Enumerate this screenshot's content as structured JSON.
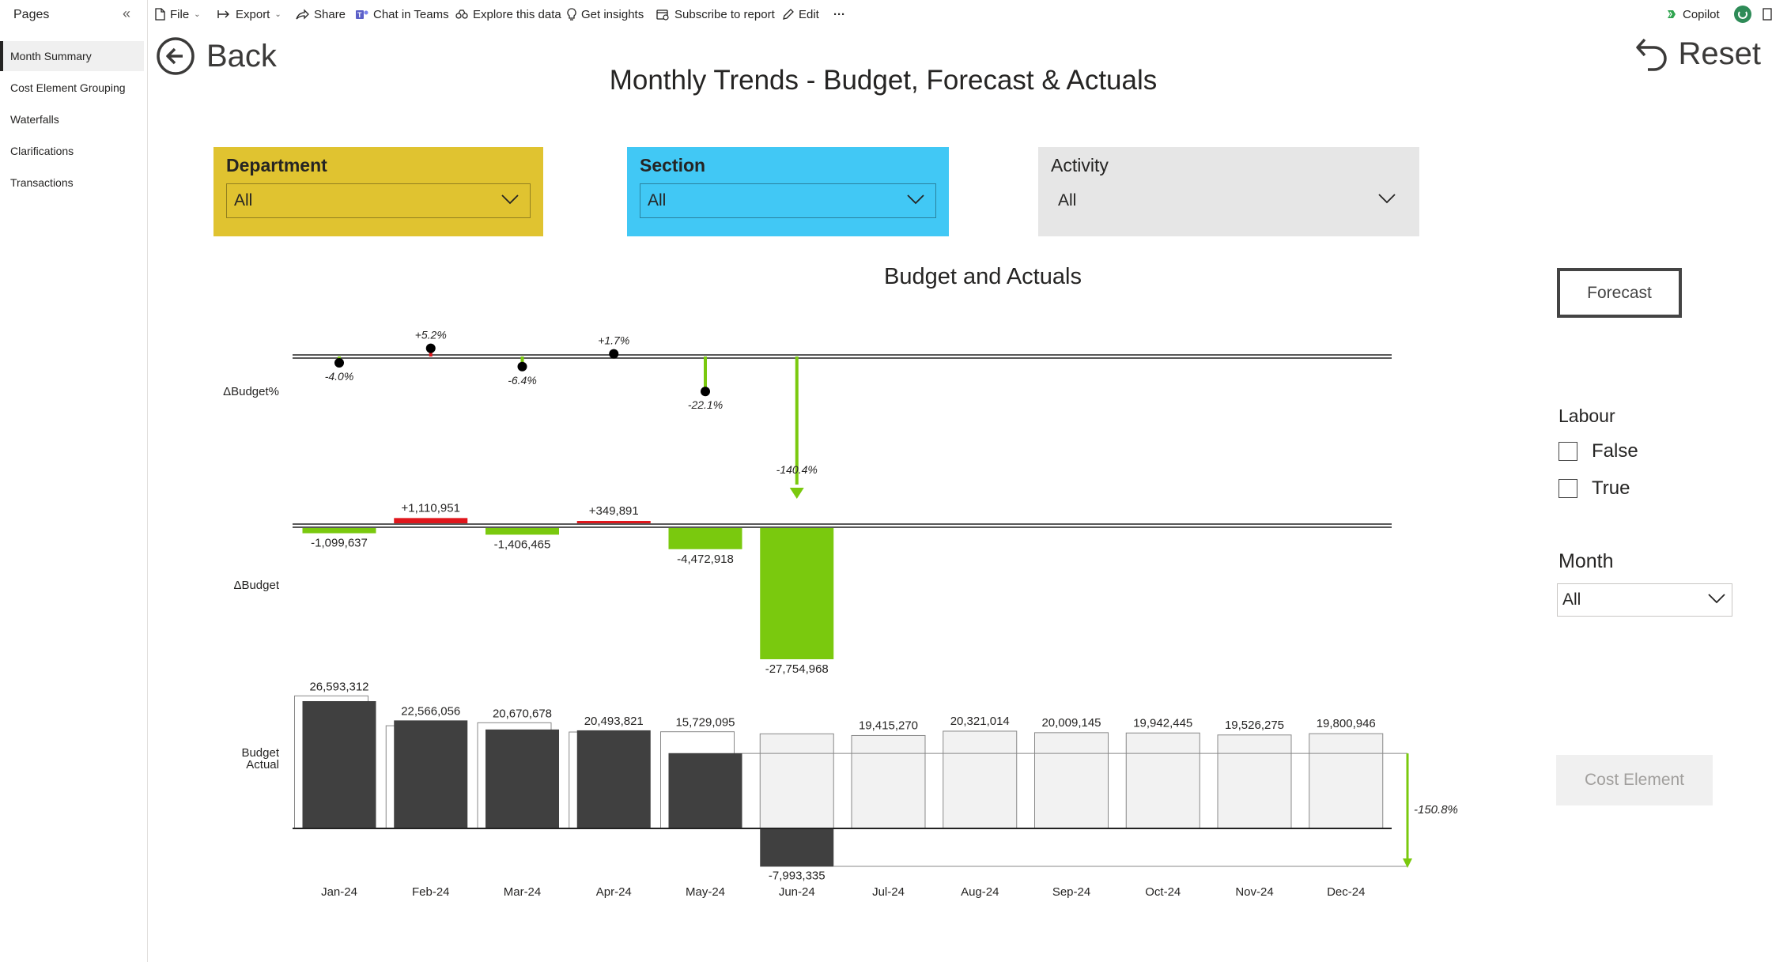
{
  "toolbar": {
    "file": "File",
    "export": "Export",
    "share": "Share",
    "chat_in_teams": "Chat in Teams",
    "explore": "Explore this data",
    "insights": "Get insights",
    "subscribe": "Subscribe to report",
    "edit": "Edit",
    "more": "···",
    "copilot": "Copilot"
  },
  "sidebar": {
    "title": "Pages",
    "collapse": "«",
    "items": [
      {
        "label": "Month Summary",
        "active": true
      },
      {
        "label": "Cost Element Grouping"
      },
      {
        "label": "Waterfalls"
      },
      {
        "label": "Clarifications"
      },
      {
        "label": "Transactions"
      }
    ]
  },
  "page": {
    "back_label": "Back",
    "reset_label": "Reset",
    "title": "Monthly Trends - Budget, Forecast & Actuals"
  },
  "slicers": {
    "department": {
      "label": "Department",
      "value": "All",
      "color": "#E0C330"
    },
    "section": {
      "label": "Section",
      "value": "All",
      "color": "#41C8F5"
    },
    "activity": {
      "label": "Activity",
      "value": "All",
      "color": "#E6E6E6"
    }
  },
  "right_panel": {
    "forecast_button": "Forecast",
    "labour_title": "Labour",
    "labour_options": [
      "False",
      "True"
    ],
    "month_title": "Month",
    "month_value": "All",
    "cost_element_button": "Cost Element"
  },
  "chart_data": {
    "type": "bar",
    "title": "Budget and Actuals",
    "categories": [
      "Jan-24",
      "Feb-24",
      "Mar-24",
      "Apr-24",
      "May-24",
      "Jun-24",
      "Jul-24",
      "Aug-24",
      "Sep-24",
      "Oct-24",
      "Nov-24",
      "Dec-24"
    ],
    "row_labels": {
      "delta_pct": "ΔBudget%",
      "delta": "ΔBudget",
      "budget_actual": [
        "Budget",
        "Actual"
      ]
    },
    "delta_budget_pct": [
      -4.0,
      5.2,
      -6.4,
      1.7,
      -22.1,
      -140.4,
      null,
      null,
      null,
      null,
      null,
      null
    ],
    "delta_budget_pct_labels": [
      "-4.0%",
      "+5.2%",
      "-6.4%",
      "+1.7%",
      "-22.1%",
      "-140.4%",
      "",
      "",
      "",
      "",
      "",
      ""
    ],
    "delta_budget": [
      -1099637,
      1110951,
      -1406465,
      349891,
      -4472918,
      -27754968,
      null,
      null,
      null,
      null,
      null,
      null
    ],
    "delta_budget_labels": [
      "-1,099,637",
      "+1,110,951",
      "-1,406,465",
      "+349,891",
      "-4,472,918",
      "-27,754,968",
      "",
      "",
      "",
      "",
      "",
      ""
    ],
    "actual": [
      26593312,
      22566056,
      20670678,
      20493821,
      15729095,
      -7993335,
      null,
      null,
      null,
      null,
      null,
      null
    ],
    "forecast": [
      null,
      null,
      null,
      null,
      null,
      null,
      19415270,
      20321014,
      20009145,
      19942445,
      19526275,
      19800946
    ],
    "value_labels": [
      "26,593,312",
      "22,566,056",
      "20,670,678",
      "20,493,821",
      "15,729,095",
      "-7,993,335",
      "19,415,270",
      "20,321,014",
      "20,009,145",
      "19,942,445",
      "19,526,275",
      "19,800,946"
    ],
    "total_variance_label": "-150.8%",
    "colors": {
      "favorable": "#7AC90E",
      "adverse": "#E0161C",
      "actual": "#404040",
      "forecast": "#F2F2F2",
      "budget_outline": "#888888"
    }
  }
}
